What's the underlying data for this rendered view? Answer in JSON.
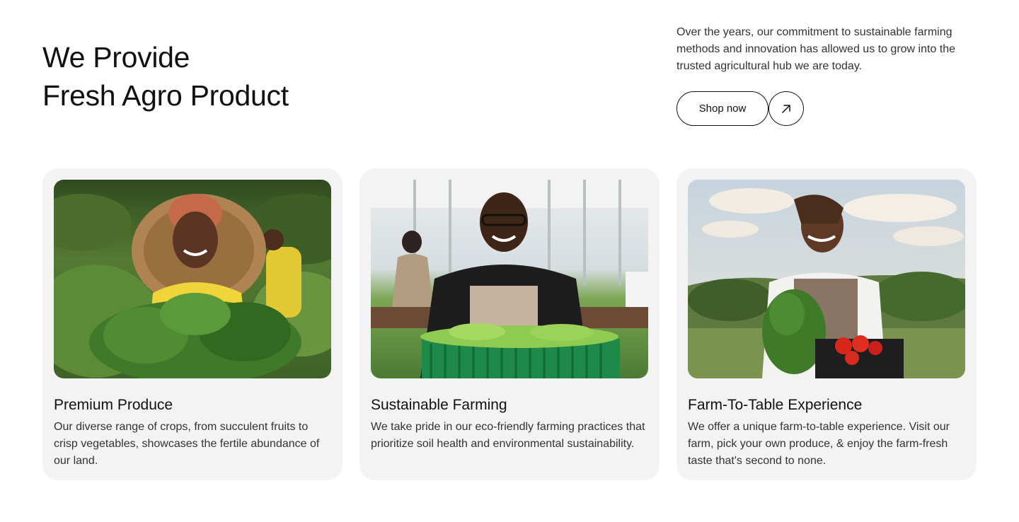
{
  "hero": {
    "title_line1": "We Provide",
    "title_line2": "Fresh Agro Product",
    "description": "Over the years, our commitment to sustainable farming methods and innovation has allowed us to grow into the trusted agricultural hub we are today.",
    "shop_label": "Shop now",
    "arrow_icon": "arrow-up-right-icon"
  },
  "cards": [
    {
      "title": "Premium Produce",
      "description": "Our diverse range of crops, from succulent fruits to crisp vegetables, showcases the fertile abundance of our land.",
      "photo": "woman-with-leafy-greens-photo"
    },
    {
      "title": "Sustainable Farming",
      "description": "We take pride in our eco-friendly farming practices that prioritize soil health and environmental sustainability.",
      "photo": "woman-greenhouse-lettuce-crate-photo"
    },
    {
      "title": "Farm-To-Table Experience",
      "description": "We offer a unique farm-to-table experience. Visit our farm, pick your own produce, & enjoy the farm-fresh taste that's second to none.",
      "photo": "woman-field-vegetable-basket-photo"
    }
  ],
  "colors": {
    "card_bg": "#f3f3f3",
    "text": "#111111",
    "muted_text": "#333333"
  }
}
